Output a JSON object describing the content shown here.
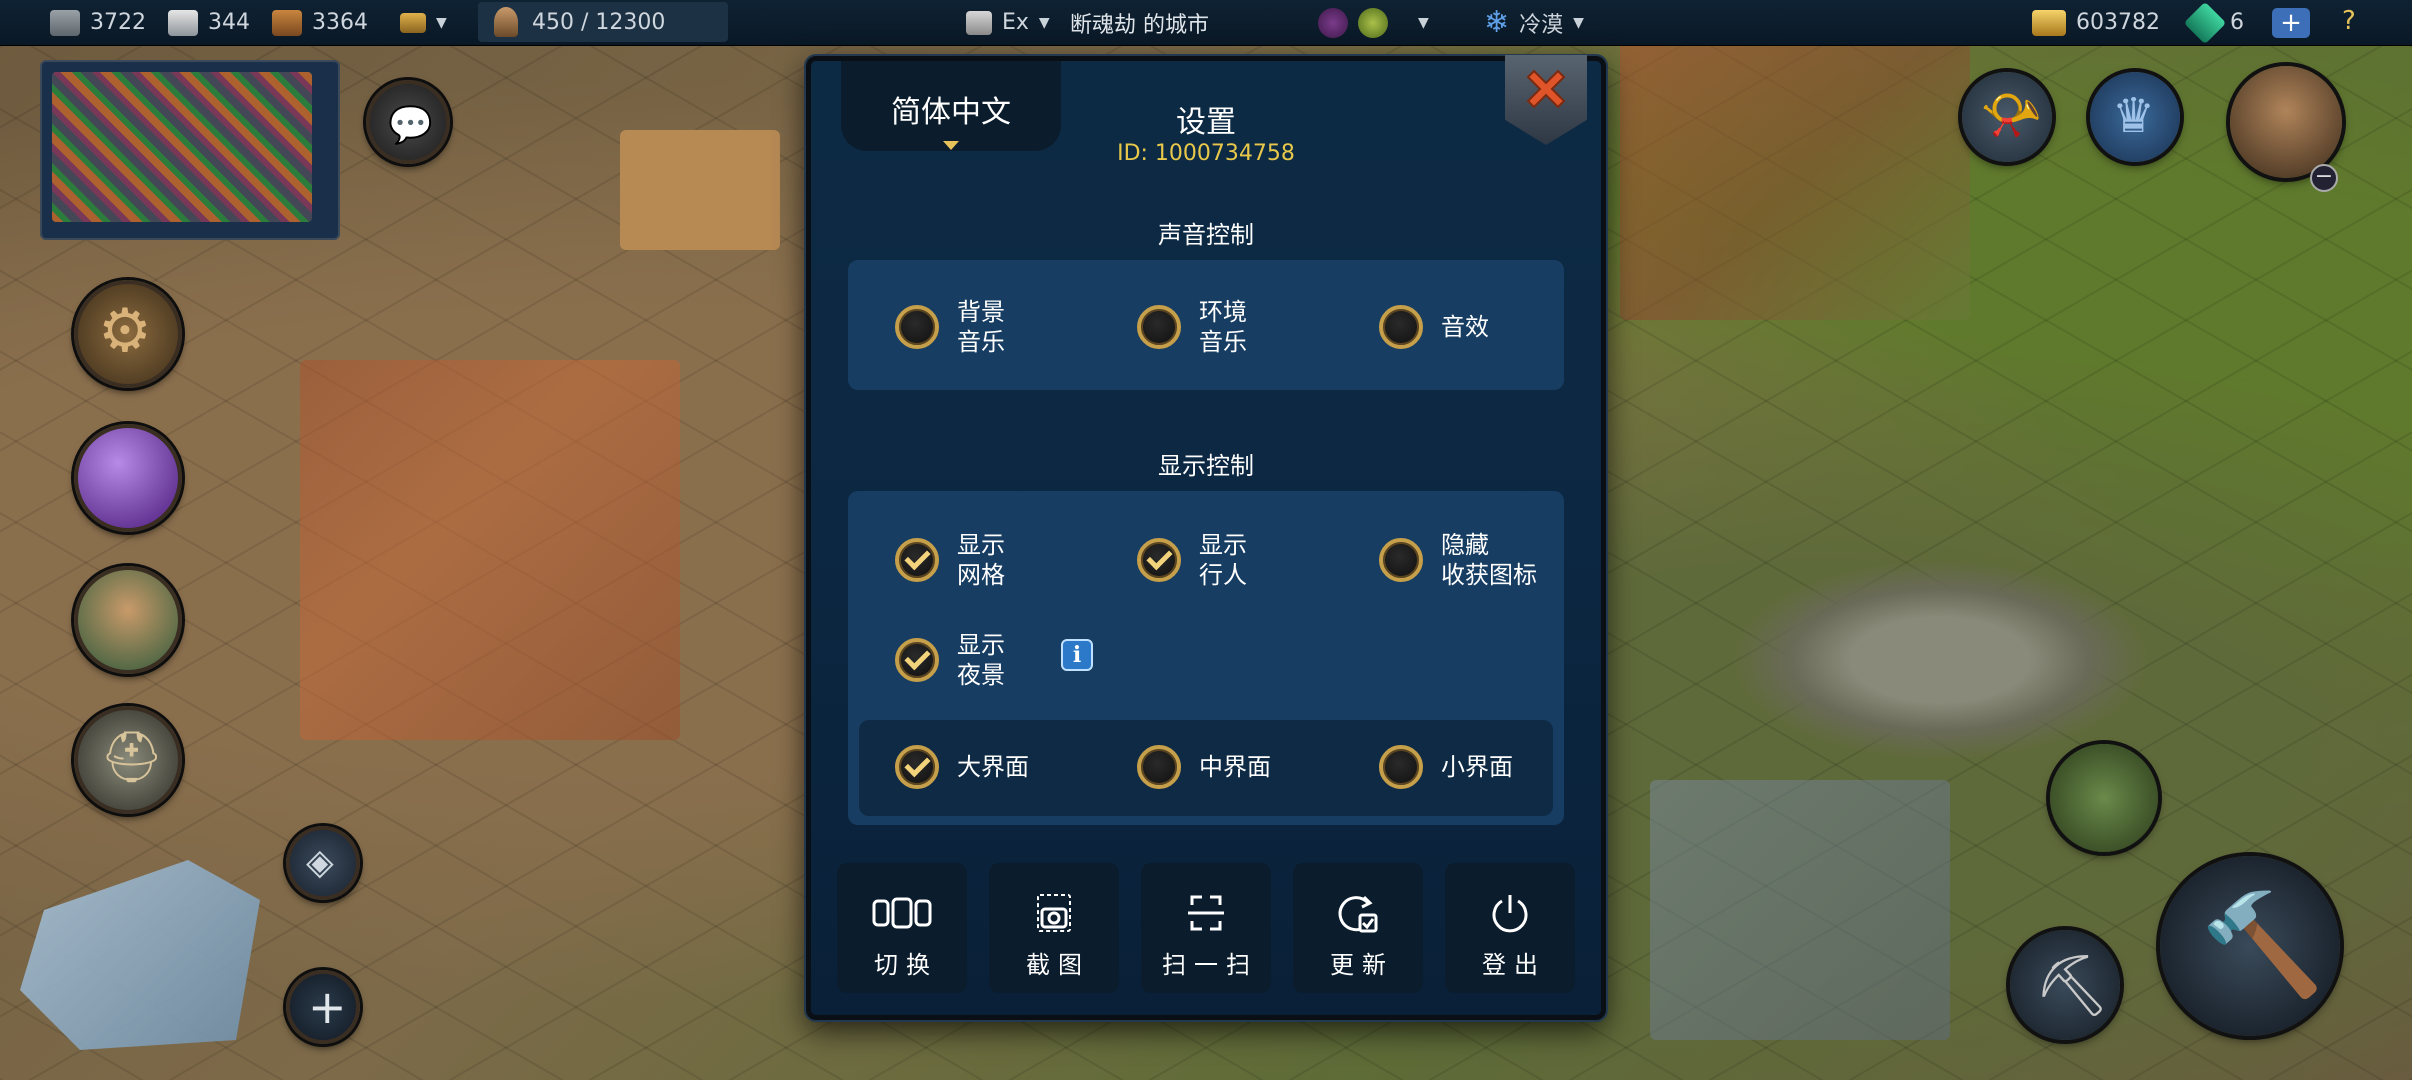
{
  "topbar": {
    "resources": [
      {
        "icon": "stone-block-icon",
        "value": "3722"
      },
      {
        "icon": "marble-icon",
        "value": "344"
      },
      {
        "icon": "wood-icon",
        "value": "3364"
      }
    ],
    "storage_icon": "warehouse-icon",
    "population": "450 / 12300",
    "difficulty": "Ex",
    "city_name": "断魂劫 的城市",
    "goods_icons": [
      "grapes-icon",
      "olive-icon"
    ],
    "season": "冷漠",
    "gold": "603782",
    "gems": "6",
    "plus_label": "+",
    "help_label": "?"
  },
  "settings": {
    "language": "简体中文",
    "title": "设置",
    "id_text": "ID: 1000734758",
    "sound_section_title": "声音控制",
    "sound_options": [
      {
        "label": "背景\n音乐",
        "checked": false
      },
      {
        "label": "环境\n音乐",
        "checked": false
      },
      {
        "label": "音效",
        "checked": false
      }
    ],
    "display_section_title": "显示控制",
    "display_options": [
      {
        "label": "显示\n网格",
        "checked": true
      },
      {
        "label": "显示\n行人",
        "checked": true
      },
      {
        "label": "隐藏\n收获图标",
        "checked": false
      },
      {
        "label": "显示\n夜景",
        "checked": true
      }
    ],
    "info_label": "i",
    "ui_size_options": [
      {
        "label": "大界面",
        "checked": true
      },
      {
        "label": "中界面",
        "checked": false
      },
      {
        "label": "小界面",
        "checked": false
      }
    ],
    "actions": [
      {
        "label": "切换",
        "icon": "switch-accounts-icon"
      },
      {
        "label": "截图",
        "icon": "screenshot-icon"
      },
      {
        "label": "扫一扫",
        "icon": "scan-icon"
      },
      {
        "label": "更新",
        "icon": "update-icon"
      },
      {
        "label": "登出",
        "icon": "power-icon"
      }
    ]
  },
  "colors": {
    "dialog_bg": "#0c2742",
    "panel_bg": "#173d62",
    "accent_gold": "#e8c84a",
    "close_red": "#e0542a"
  }
}
